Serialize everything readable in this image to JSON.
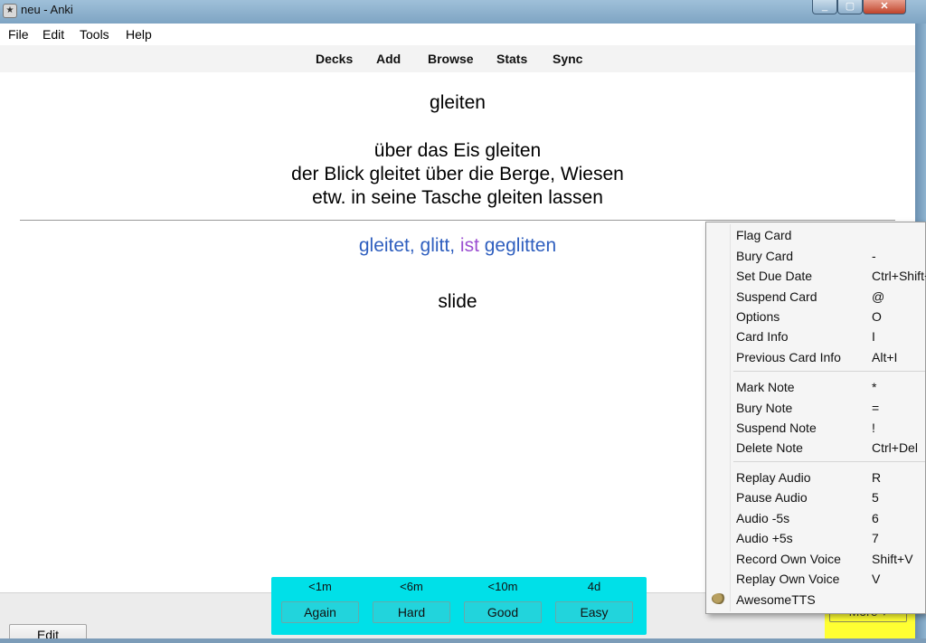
{
  "window": {
    "title": "neu - Anki",
    "close_glyph": "✕",
    "min_glyph": "_",
    "max_glyph": "▢"
  },
  "menubar": {
    "file": "File",
    "edit": "Edit",
    "tools": "Tools",
    "help": "Help"
  },
  "toolbar": {
    "decks": "Decks",
    "add": "Add",
    "browse": "Browse",
    "stats": "Stats",
    "sync": "Sync"
  },
  "card": {
    "front_word": "gleiten",
    "examples": [
      "über das Eis gleiten",
      "der Blick gleitet über die Berge, Wiesen",
      "etw. in seine Tasche gleiten lassen"
    ],
    "forms": {
      "part1": "gleitet, glitt, ",
      "part2": "ist",
      "part3": " geglitten"
    },
    "meaning": "slide",
    "colors": {
      "forms_blue": "#2f5fbf",
      "forms_purple": "#9b4fd1"
    }
  },
  "bottom": {
    "edit_label": "Edit",
    "answers": [
      {
        "time": "<1m",
        "label": "Again"
      },
      {
        "time": "<6m",
        "label": "Hard"
      },
      {
        "time": "<10m",
        "label": "Good"
      },
      {
        "time": "4d",
        "label": "Easy"
      }
    ],
    "more_label": "More ▾",
    "highlight_cyan": "#00e0e8",
    "highlight_yellow": "#ffff33"
  },
  "context_menu": {
    "items": [
      {
        "label": "Flag Card",
        "shortcut": ""
      },
      {
        "label": "Bury Card",
        "shortcut": "-"
      },
      {
        "label": "Set Due Date",
        "shortcut": "Ctrl+Shift+"
      },
      {
        "label": "Suspend Card",
        "shortcut": "@"
      },
      {
        "label": "Options",
        "shortcut": "O"
      },
      {
        "label": "Card Info",
        "shortcut": "I"
      },
      {
        "label": "Previous Card Info",
        "shortcut": "Alt+I"
      },
      {
        "label": "Mark Note",
        "shortcut": "*"
      },
      {
        "label": "Bury Note",
        "shortcut": "="
      },
      {
        "label": "Suspend Note",
        "shortcut": "!"
      },
      {
        "label": "Delete Note",
        "shortcut": "Ctrl+Del"
      },
      {
        "label": "Replay Audio",
        "shortcut": "R"
      },
      {
        "label": "Pause Audio",
        "shortcut": "5"
      },
      {
        "label": "Audio -5s",
        "shortcut": "6"
      },
      {
        "label": "Audio +5s",
        "shortcut": "7"
      },
      {
        "label": "Record Own Voice",
        "shortcut": "Shift+V"
      },
      {
        "label": "Replay Own Voice",
        "shortcut": "V"
      },
      {
        "label": "AwesomeTTS",
        "shortcut": "",
        "icon": "awesometts-icon"
      }
    ]
  }
}
